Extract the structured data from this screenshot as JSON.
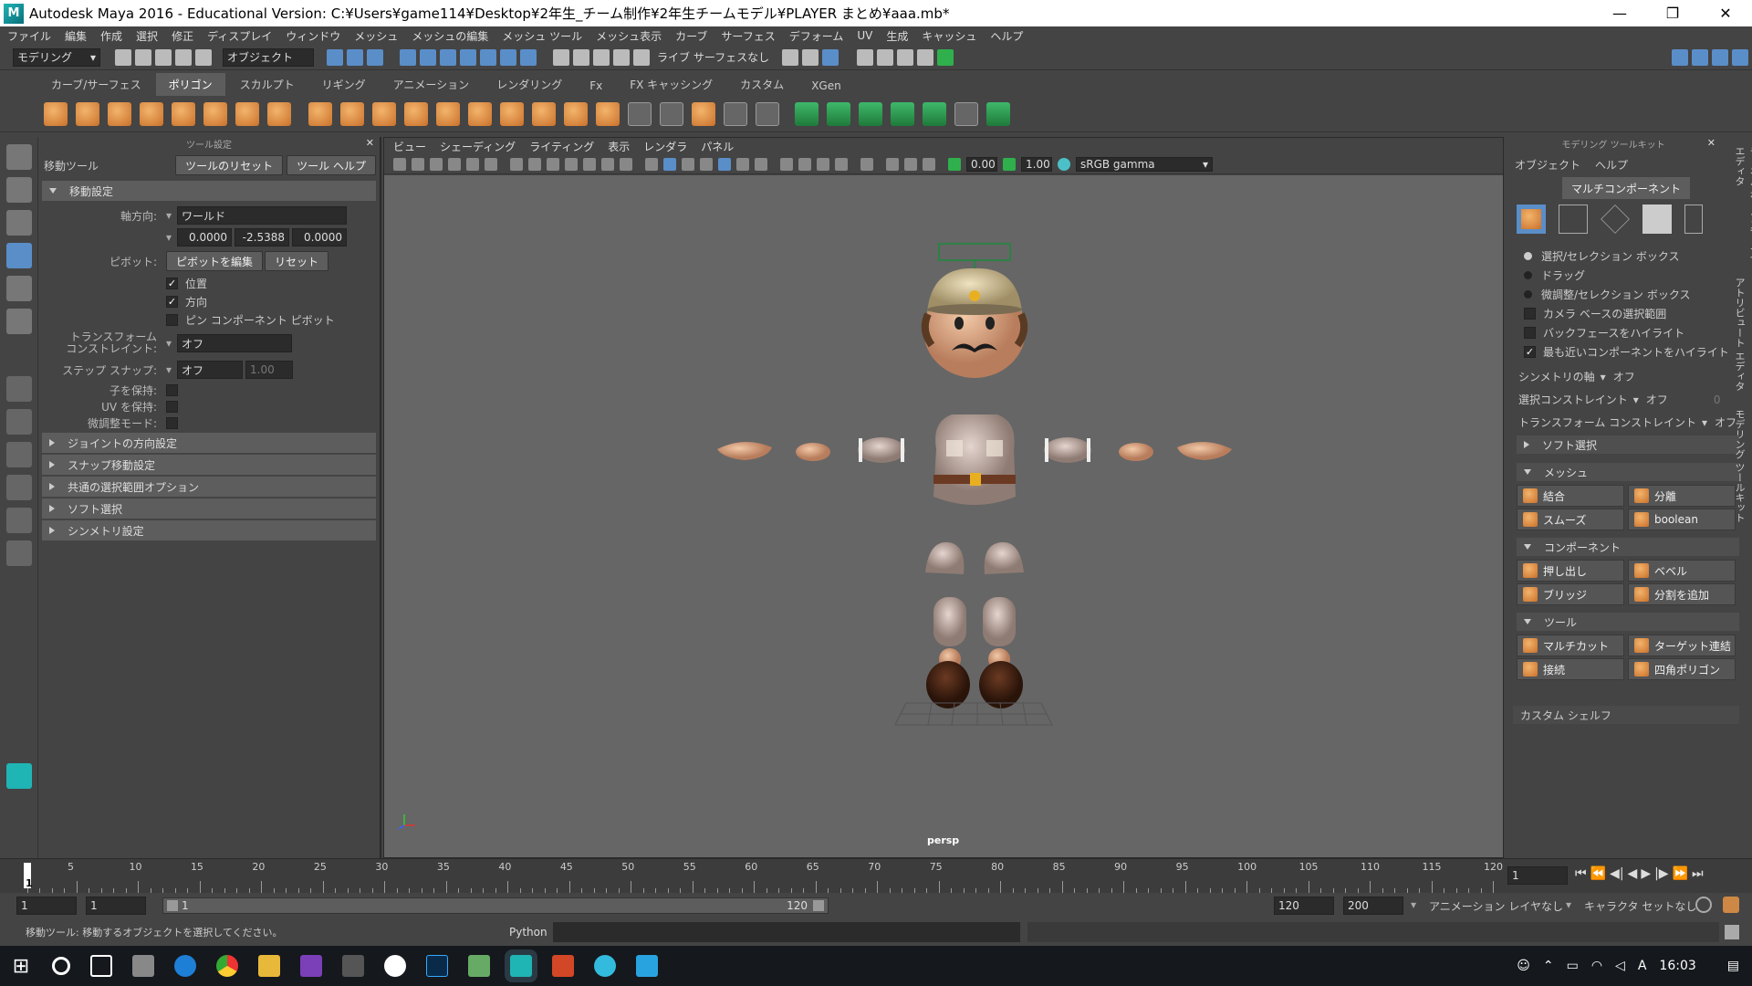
{
  "title": "Autodesk Maya 2016 - Educational Version: C:¥Users¥game114¥Desktop¥2年生_チーム制作¥2年生チームモデル¥PLAYER まとめ¥aaa.mb*",
  "window_buttons": [
    "—",
    "❐",
    "✕"
  ],
  "menu": [
    "ファイル",
    "編集",
    "作成",
    "選択",
    "修正",
    "ディスプレイ",
    "ウィンドウ",
    "メッシュ",
    "メッシュの編集",
    "メッシュ ツール",
    "メッシュ表示",
    "カーブ",
    "サーフェス",
    "デフォーム",
    "UV",
    "生成",
    "キャッシュ",
    "ヘルプ"
  ],
  "status": {
    "mode": "モデリング",
    "selmode": "オブジェクト",
    "live": "ライブ サーフェスなし"
  },
  "shelf_tabs": [
    "カーブ/サーフェス",
    "ポリゴン",
    "スカルプト",
    "リギング",
    "アニメーション",
    "レンダリング",
    "Fx",
    "FX キャッシング",
    "カスタム",
    "XGen"
  ],
  "shelf_active": "ポリゴン",
  "tool_settings": {
    "panel_title": "ツール設定",
    "tool_name": "移動ツール",
    "reset_btn": "ツールのリセット",
    "help_btn": "ツール ヘルプ",
    "section_main": "移動設定",
    "axis_label": "軸方向:",
    "axis_value": "ワールド",
    "x": "0.0000",
    "y": "-2.5388",
    "z": "0.0000",
    "pivot_label": "ピボット:",
    "pivot_edit": "ピボットを編集",
    "pivot_reset": "リセット",
    "chk_pos": "位置",
    "chk_dir": "方向",
    "chk_pin": "ピン コンポーネント ピボット",
    "transform_label_1": "トランスフォーム",
    "transform_label_2": "コンストレイント:",
    "transform_value": "オフ",
    "step_label": "ステップ スナップ:",
    "step_value": "オフ",
    "step_num": "1.00",
    "keep_child": "子を保持:",
    "keep_uv": "UV を保持:",
    "tweak": "微調整モード:",
    "sections": [
      "ジョイントの方向設定",
      "スナップ移動設定",
      "共通の選択範囲オプション",
      "ソフト選択",
      "シンメトリ設定"
    ]
  },
  "viewport": {
    "menu": [
      "ビュー",
      "シェーディング",
      "ライティング",
      "表示",
      "レンダラ",
      "パネル"
    ],
    "val1": "0.00",
    "val2": "1.00",
    "color_space": "sRGB gamma",
    "camera": "persp"
  },
  "modeling_toolkit": {
    "panel_title": "モデリング ツールキット",
    "menu": [
      "オブジェクト",
      "ヘルプ"
    ],
    "multi": "マルチコンポーネント",
    "radios": [
      "選択/セレクション ボックス",
      "ドラッグ",
      "微調整/セレクション ボックス"
    ],
    "checks": [
      "カメラ ベースの選択範囲",
      "バックフェースをハイライト",
      "最も近いコンポーネントをハイライト"
    ],
    "sym_label": "シンメトリの軸",
    "sym_value": "オフ",
    "sel_constraint": "選択コンストレイント",
    "sel_value": "オフ",
    "sel_num": "0",
    "tr_constraint": "トランスフォーム コンストレイント",
    "tr_value": "オフ",
    "soft": "ソフト選択",
    "mesh": "メッシュ",
    "mesh_btns": [
      "結合",
      "分離",
      "スムーズ",
      "boolean"
    ],
    "component": "コンポーネント",
    "comp_btns": [
      "押し出し",
      "ベベル",
      "ブリッジ",
      "分割を追加"
    ],
    "tools": "ツール",
    "tool_btns": [
      "マルチカット",
      "ターゲット連結",
      "接続",
      "四角ポリゴン"
    ],
    "custom_shelf": "カスタム シェルフ"
  },
  "side_tabs": [
    "チャネル ボックス/レイヤ エディタ",
    "アトリビュート エディタ",
    "モデリング ツールキット"
  ],
  "timeline": {
    "ticks": [
      5,
      10,
      15,
      20,
      25,
      30,
      35,
      40,
      45,
      50,
      55,
      60,
      65,
      70,
      75,
      80,
      85,
      90,
      95,
      100,
      105,
      110,
      115,
      120
    ],
    "current": "1",
    "current_frame_field": "1"
  },
  "range": {
    "start": "1",
    "start2": "1",
    "slider_start": "1",
    "slider_end": "120",
    "end": "120",
    "end2": "200",
    "anim_layer": "アニメーション レイヤなし",
    "char_set": "キャラクタ セットなし"
  },
  "help_line": "移動ツール: 移動するオブジェクトを選択してください。",
  "python_label": "Python",
  "clock": "16:03"
}
